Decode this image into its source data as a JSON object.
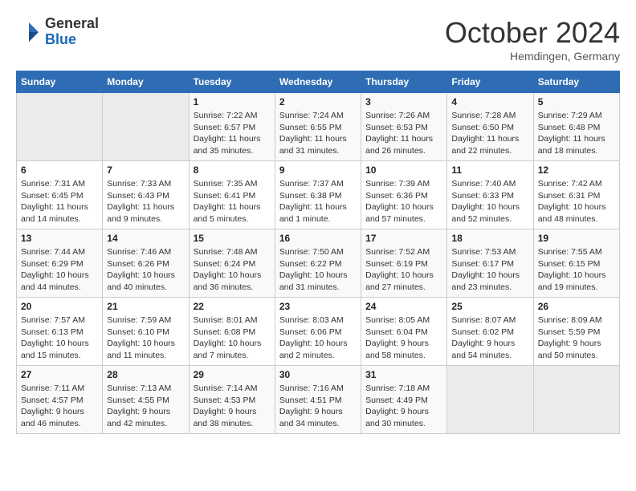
{
  "header": {
    "logo": {
      "general": "General",
      "blue": "Blue"
    },
    "title": "October 2024",
    "location": "Hemdingen, Germany"
  },
  "weekdays": [
    "Sunday",
    "Monday",
    "Tuesday",
    "Wednesday",
    "Thursday",
    "Friday",
    "Saturday"
  ],
  "weeks": [
    [
      {
        "day": "",
        "sunrise": "",
        "sunset": "",
        "daylight": ""
      },
      {
        "day": "",
        "sunrise": "",
        "sunset": "",
        "daylight": ""
      },
      {
        "day": "1",
        "sunrise": "Sunrise: 7:22 AM",
        "sunset": "Sunset: 6:57 PM",
        "daylight": "Daylight: 11 hours and 35 minutes."
      },
      {
        "day": "2",
        "sunrise": "Sunrise: 7:24 AM",
        "sunset": "Sunset: 6:55 PM",
        "daylight": "Daylight: 11 hours and 31 minutes."
      },
      {
        "day": "3",
        "sunrise": "Sunrise: 7:26 AM",
        "sunset": "Sunset: 6:53 PM",
        "daylight": "Daylight: 11 hours and 26 minutes."
      },
      {
        "day": "4",
        "sunrise": "Sunrise: 7:28 AM",
        "sunset": "Sunset: 6:50 PM",
        "daylight": "Daylight: 11 hours and 22 minutes."
      },
      {
        "day": "5",
        "sunrise": "Sunrise: 7:29 AM",
        "sunset": "Sunset: 6:48 PM",
        "daylight": "Daylight: 11 hours and 18 minutes."
      }
    ],
    [
      {
        "day": "6",
        "sunrise": "Sunrise: 7:31 AM",
        "sunset": "Sunset: 6:45 PM",
        "daylight": "Daylight: 11 hours and 14 minutes."
      },
      {
        "day": "7",
        "sunrise": "Sunrise: 7:33 AM",
        "sunset": "Sunset: 6:43 PM",
        "daylight": "Daylight: 11 hours and 9 minutes."
      },
      {
        "day": "8",
        "sunrise": "Sunrise: 7:35 AM",
        "sunset": "Sunset: 6:41 PM",
        "daylight": "Daylight: 11 hours and 5 minutes."
      },
      {
        "day": "9",
        "sunrise": "Sunrise: 7:37 AM",
        "sunset": "Sunset: 6:38 PM",
        "daylight": "Daylight: 11 hours and 1 minute."
      },
      {
        "day": "10",
        "sunrise": "Sunrise: 7:39 AM",
        "sunset": "Sunset: 6:36 PM",
        "daylight": "Daylight: 10 hours and 57 minutes."
      },
      {
        "day": "11",
        "sunrise": "Sunrise: 7:40 AM",
        "sunset": "Sunset: 6:33 PM",
        "daylight": "Daylight: 10 hours and 52 minutes."
      },
      {
        "day": "12",
        "sunrise": "Sunrise: 7:42 AM",
        "sunset": "Sunset: 6:31 PM",
        "daylight": "Daylight: 10 hours and 48 minutes."
      }
    ],
    [
      {
        "day": "13",
        "sunrise": "Sunrise: 7:44 AM",
        "sunset": "Sunset: 6:29 PM",
        "daylight": "Daylight: 10 hours and 44 minutes."
      },
      {
        "day": "14",
        "sunrise": "Sunrise: 7:46 AM",
        "sunset": "Sunset: 6:26 PM",
        "daylight": "Daylight: 10 hours and 40 minutes."
      },
      {
        "day": "15",
        "sunrise": "Sunrise: 7:48 AM",
        "sunset": "Sunset: 6:24 PM",
        "daylight": "Daylight: 10 hours and 36 minutes."
      },
      {
        "day": "16",
        "sunrise": "Sunrise: 7:50 AM",
        "sunset": "Sunset: 6:22 PM",
        "daylight": "Daylight: 10 hours and 31 minutes."
      },
      {
        "day": "17",
        "sunrise": "Sunrise: 7:52 AM",
        "sunset": "Sunset: 6:19 PM",
        "daylight": "Daylight: 10 hours and 27 minutes."
      },
      {
        "day": "18",
        "sunrise": "Sunrise: 7:53 AM",
        "sunset": "Sunset: 6:17 PM",
        "daylight": "Daylight: 10 hours and 23 minutes."
      },
      {
        "day": "19",
        "sunrise": "Sunrise: 7:55 AM",
        "sunset": "Sunset: 6:15 PM",
        "daylight": "Daylight: 10 hours and 19 minutes."
      }
    ],
    [
      {
        "day": "20",
        "sunrise": "Sunrise: 7:57 AM",
        "sunset": "Sunset: 6:13 PM",
        "daylight": "Daylight: 10 hours and 15 minutes."
      },
      {
        "day": "21",
        "sunrise": "Sunrise: 7:59 AM",
        "sunset": "Sunset: 6:10 PM",
        "daylight": "Daylight: 10 hours and 11 minutes."
      },
      {
        "day": "22",
        "sunrise": "Sunrise: 8:01 AM",
        "sunset": "Sunset: 6:08 PM",
        "daylight": "Daylight: 10 hours and 7 minutes."
      },
      {
        "day": "23",
        "sunrise": "Sunrise: 8:03 AM",
        "sunset": "Sunset: 6:06 PM",
        "daylight": "Daylight: 10 hours and 2 minutes."
      },
      {
        "day": "24",
        "sunrise": "Sunrise: 8:05 AM",
        "sunset": "Sunset: 6:04 PM",
        "daylight": "Daylight: 9 hours and 58 minutes."
      },
      {
        "day": "25",
        "sunrise": "Sunrise: 8:07 AM",
        "sunset": "Sunset: 6:02 PM",
        "daylight": "Daylight: 9 hours and 54 minutes."
      },
      {
        "day": "26",
        "sunrise": "Sunrise: 8:09 AM",
        "sunset": "Sunset: 5:59 PM",
        "daylight": "Daylight: 9 hours and 50 minutes."
      }
    ],
    [
      {
        "day": "27",
        "sunrise": "Sunrise: 7:11 AM",
        "sunset": "Sunset: 4:57 PM",
        "daylight": "Daylight: 9 hours and 46 minutes."
      },
      {
        "day": "28",
        "sunrise": "Sunrise: 7:13 AM",
        "sunset": "Sunset: 4:55 PM",
        "daylight": "Daylight: 9 hours and 42 minutes."
      },
      {
        "day": "29",
        "sunrise": "Sunrise: 7:14 AM",
        "sunset": "Sunset: 4:53 PM",
        "daylight": "Daylight: 9 hours and 38 minutes."
      },
      {
        "day": "30",
        "sunrise": "Sunrise: 7:16 AM",
        "sunset": "Sunset: 4:51 PM",
        "daylight": "Daylight: 9 hours and 34 minutes."
      },
      {
        "day": "31",
        "sunrise": "Sunrise: 7:18 AM",
        "sunset": "Sunset: 4:49 PM",
        "daylight": "Daylight: 9 hours and 30 minutes."
      },
      {
        "day": "",
        "sunrise": "",
        "sunset": "",
        "daylight": ""
      },
      {
        "day": "",
        "sunrise": "",
        "sunset": "",
        "daylight": ""
      }
    ]
  ]
}
